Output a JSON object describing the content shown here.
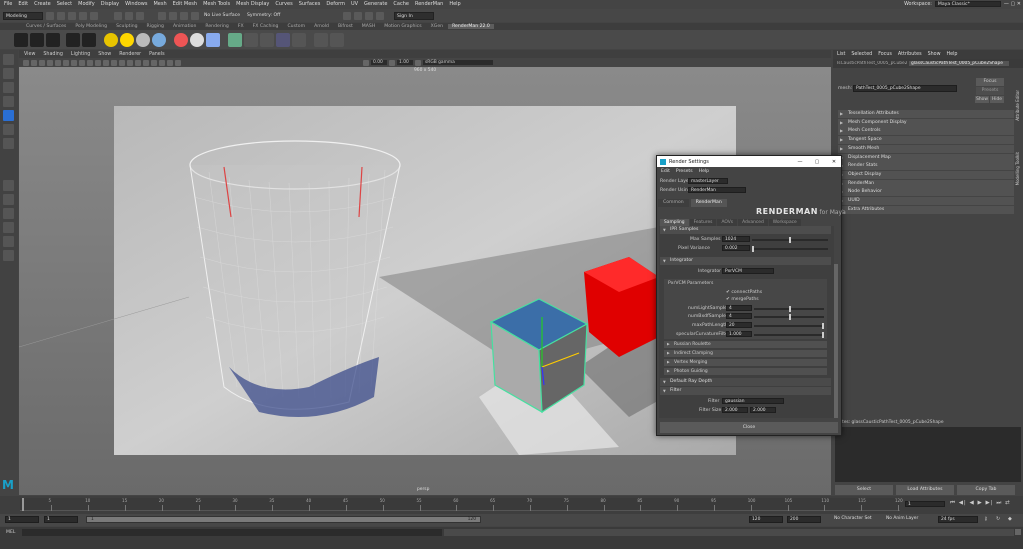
{
  "menu": {
    "items": [
      "File",
      "Edit",
      "Create",
      "Select",
      "Modify",
      "Display",
      "Windows",
      "Mesh",
      "Edit Mesh",
      "Mesh Tools",
      "Mesh Display",
      "Curves",
      "Surfaces",
      "Deform",
      "UV",
      "Generate",
      "Cache",
      "RenderMan",
      "Help"
    ],
    "workspace_label": "Workspace:",
    "workspace_value": "Maya Classic*"
  },
  "status": {
    "mode": "Modeling",
    "live_surface": "No Live Surface",
    "symmetry": "Symmetry: Off",
    "sign_in": "Sign In"
  },
  "shelf_tabs": [
    "Curves / Surfaces",
    "Poly Modeling",
    "Sculpting",
    "Rigging",
    "Animation",
    "Rendering",
    "FX",
    "FX Caching",
    "Custom",
    "Arnold",
    "Bifrost",
    "MASH",
    "Motion Graphics",
    "XGen",
    "RenderMan 22.0"
  ],
  "viewport": {
    "menu": [
      "View",
      "Shading",
      "Lighting",
      "Show",
      "Renderer",
      "Panels"
    ],
    "exposure": "0.00",
    "gamma": "1.00",
    "color_space": "sRGB gamma",
    "resolution": "960 x 540",
    "camera_label": "persp"
  },
  "attr_editor": {
    "tabs": [
      "List",
      "Selected",
      "Focus",
      "Attributes",
      "Show",
      "Help"
    ],
    "node_tabs": [
      "IsCausticPathTest_0005_pCube2",
      "glassCausticPathTest_0005_pCube2Shape"
    ],
    "mesh_label": "mesh:",
    "mesh_value": "PathTest_0005_pCube2Shape",
    "focus": "Focus",
    "presets": "Presets",
    "show": "Show",
    "hide": "Hide",
    "sections": [
      "Tessellation Attributes",
      "Mesh Component Display",
      "Mesh Controls",
      "Tangent Space",
      "Smooth Mesh",
      "Displacement Map",
      "Render Stats",
      "Object Display",
      "RenderMan",
      "Node Behavior",
      "UUID",
      "Extra Attributes"
    ],
    "notes": "Notes:  glassCausticPathTest_0005_pCube2Shape",
    "buttons": [
      "Select",
      "Load Attributes",
      "Copy Tab"
    ],
    "side_tab1": "Attribute Editor",
    "side_tab2": "Modelling Toolkit"
  },
  "render_settings": {
    "title": "Render Settings",
    "menu": [
      "Edit",
      "Presets",
      "Help"
    ],
    "render_layer_label": "Render Layer",
    "render_layer": "masterLayer",
    "render_using_label": "Render Using",
    "render_using": "RenderMan",
    "tabs": [
      "Common",
      "RenderMan"
    ],
    "logo_main": "RENDERMAN",
    "logo_for": "for Maya",
    "subtabs": [
      "Sampling",
      "Features",
      "AOVs",
      "Advanced",
      "Workspace"
    ],
    "ipr_samples": "IPR Samples",
    "max_samples_label": "Max Samples",
    "max_samples": "1024",
    "pixel_variance_label": "Pixel Variance",
    "pixel_variance": "0.002",
    "integrator_header": "Integrator",
    "integrator_label": "Integrator",
    "integrator": "PxrVCM",
    "pxrvcm_header": "PxrVCM Parameters",
    "connect_paths": "connectPaths",
    "merge_paths": "mergePaths",
    "num_light_label": "numLightSamples",
    "num_light": "4",
    "num_bxdf_label": "numBxdfSamples",
    "num_bxdf": "4",
    "max_path_label": "maxPathLength",
    "max_path": "20",
    "specular_label": "specularCurvatureFilter",
    "specular": "1.000",
    "sub_sections": [
      "Russian Roulette",
      "Indirect Clamping",
      "Vertex Merging",
      "Photon Guiding"
    ],
    "default_ray_depth": "Default Ray Depth",
    "filter_header": "Filter",
    "filter_label": "Filter",
    "filter": "gaussian",
    "filter_size_label": "Filter Size",
    "filter_size_x": "2.000",
    "filter_size_y": "2.000",
    "close": "Close"
  },
  "timeline": {
    "ticks": [
      "5",
      "10",
      "15",
      "20",
      "25",
      "30",
      "35",
      "40",
      "45",
      "50",
      "55",
      "60",
      "65",
      "70",
      "75",
      "80",
      "85",
      "90",
      "95",
      "100",
      "105",
      "110",
      "115",
      "120"
    ],
    "current": "1"
  },
  "range": {
    "start": "1",
    "start2": "1",
    "range_start": "1",
    "range_end": "120",
    "end1": "120",
    "end2": "200",
    "character_set": "No Character Set",
    "anim_layer": "No Anim Layer",
    "fps": "24 fps"
  },
  "cmd": {
    "mel": "MEL"
  }
}
